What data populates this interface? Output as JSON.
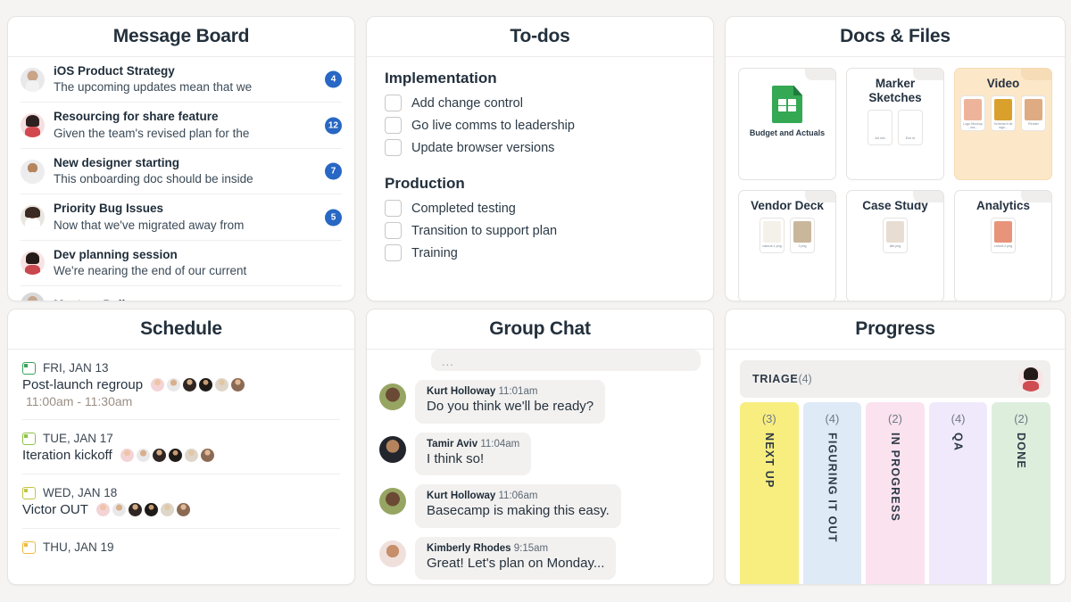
{
  "panels": {
    "message_board": {
      "title": "Message Board",
      "items": [
        {
          "title": "iOS Product Strategy",
          "snippet": "The upcoming updates mean that we",
          "badge": "4"
        },
        {
          "title": "Resourcing for share feature",
          "snippet": "Given the team's revised plan for the",
          "badge": "12"
        },
        {
          "title": "New designer starting",
          "snippet": "This onboarding doc should be inside",
          "badge": "7"
        },
        {
          "title": "Priority Bug Issues",
          "snippet": "Now that we've migrated away from",
          "badge": "5"
        },
        {
          "title": "Dev planning session",
          "snippet": "We're nearing the end of our current",
          "badge": ""
        },
        {
          "title": "Meet-up Poll",
          "snippet": "",
          "badge": ""
        }
      ]
    },
    "todos": {
      "title": "To-dos",
      "groups": [
        {
          "name": "Implementation",
          "items": [
            "Add change control",
            "Go live comms to leadership",
            "Update browser versions"
          ]
        },
        {
          "name": "Production",
          "items": [
            "Completed testing",
            "Transition to support plan",
            "Training"
          ]
        }
      ]
    },
    "docs_files": {
      "title": "Docs & Files",
      "cards": [
        {
          "name": "Budget and Actuals",
          "kind": "spreadsheet",
          "highlight": false,
          "thumbs": []
        },
        {
          "name": "Marker Sketches",
          "kind": "folder",
          "highlight": false,
          "thumbs": [
            {
              "caption": "Ad min",
              "color": "#ffffff"
            },
            {
              "caption": "Eve nt",
              "color": "#ffffff"
            }
          ]
        },
        {
          "name": "Video",
          "kind": "folder",
          "highlight": true,
          "thumbs": [
            {
              "caption": "Logo Mockup - ora...",
              "color": "#edb49b"
            },
            {
              "caption": "Schema ti design...",
              "color": "#d9a12c"
            },
            {
              "caption": "Render",
              "color": "#dfab82"
            }
          ]
        },
        {
          "name": "Vendor Deck",
          "kind": "folder",
          "highlight": false,
          "thumbs": [
            {
              "caption": "natural-1.png",
              "color": "#f4f0ea"
            },
            {
              "caption": "2.png",
              "color": "#c9b79c"
            }
          ]
        },
        {
          "name": "Case Study",
          "kind": "folder",
          "highlight": false,
          "thumbs": [
            {
              "caption": "site.png",
              "color": "#e8ddd2"
            }
          ]
        },
        {
          "name": "Analytics",
          "kind": "folder",
          "highlight": false,
          "thumbs": [
            {
              "caption": "cohort-2.png",
              "color": "#e8947a"
            }
          ]
        }
      ]
    },
    "schedule": {
      "title": "Schedule",
      "events": [
        {
          "date": "FRI, JAN 13",
          "title": "Post-launch regroup",
          "time": "11:00am - 11:30am",
          "avatars": 6,
          "accent": "#3aa35a"
        },
        {
          "date": "TUE, JAN 17",
          "title": "Iteration kickoff",
          "time": "",
          "avatars": 6,
          "accent": "#8ec24a"
        },
        {
          "date": "WED, JAN 18",
          "title": "Victor OUT",
          "time": "",
          "avatars": 6,
          "accent": "#c3c53f"
        },
        {
          "date": "THU, JAN 19",
          "title": "",
          "time": "",
          "avatars": 0,
          "accent": "#f0bb3c"
        }
      ]
    },
    "group_chat": {
      "title": "Group Chat",
      "truncated_bubble": "...",
      "messages": [
        {
          "name": "Kurt Holloway",
          "time": "11:01am",
          "text": "Do you think we'll be ready?"
        },
        {
          "name": "Tamir Aviv",
          "time": "11:04am",
          "text": "I think so!"
        },
        {
          "name": "Kurt Holloway",
          "time": "11:06am",
          "text": "Basecamp is making this easy."
        },
        {
          "name": "Kimberly Rhodes",
          "time": "9:15am",
          "text": "Great! Let's plan on Monday..."
        }
      ]
    },
    "progress": {
      "title": "Progress",
      "triage_label": "TRIAGE",
      "triage_count": "(4)",
      "columns": [
        {
          "name": "NEXT UP",
          "count": "(3)",
          "color": "#f8ee80"
        },
        {
          "name": "FIGURING IT OUT",
          "count": "(4)",
          "color": "#dfeaf7"
        },
        {
          "name": "IN PROGRESS",
          "count": "(2)",
          "color": "#fbe2ef"
        },
        {
          "name": "QA",
          "count": "(4)",
          "color": "#f0e9fb"
        },
        {
          "name": "DONE",
          "count": "(2)",
          "color": "#ddeedd"
        }
      ]
    }
  },
  "colors": {
    "badge_blue": "#2867c4",
    "page_bg": "#f5f4f3",
    "card_bg": "#ffffff",
    "highlight_amber": "#fce8c8"
  }
}
